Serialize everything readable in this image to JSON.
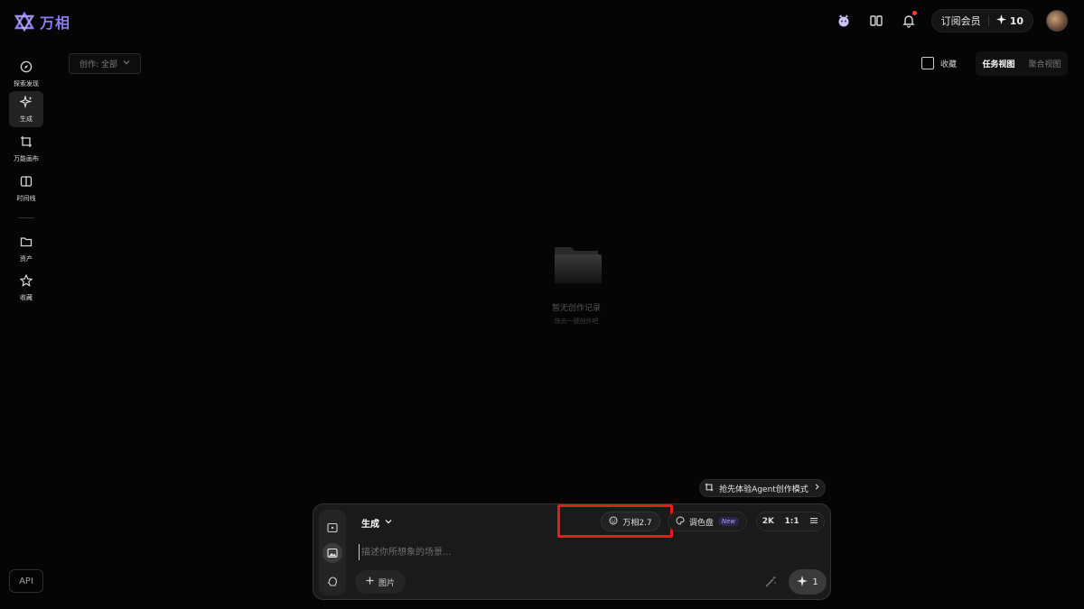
{
  "header": {
    "app_name": "万相",
    "member_label": "订阅会员",
    "points": "10"
  },
  "sidebar": {
    "items": [
      {
        "label": "探索发现",
        "icon": "compass-icon"
      },
      {
        "label": "生成",
        "icon": "sparkle-icon"
      },
      {
        "label": "万能画布",
        "icon": "crop-icon"
      },
      {
        "label": "时间线",
        "icon": "split-view-icon"
      },
      {
        "label": "资产",
        "icon": "folder-icon"
      },
      {
        "label": "收藏",
        "icon": "star-icon"
      }
    ],
    "api_label": "API"
  },
  "toolbar": {
    "filter_label": "创作: 全部",
    "favorites_label": "收藏",
    "view_tabs": [
      "任务视图",
      "聚合视图"
    ]
  },
  "empty_state": {
    "title": "暂无创作记录",
    "subtitle": "快去一键创作吧"
  },
  "agent_button": {
    "label": "抢先体验Agent创作模式"
  },
  "composer": {
    "mode_label": "生成",
    "model_label": "万相2.7",
    "palette_label": "调色盘",
    "new_badge": "New",
    "resolution": "2K",
    "aspect_ratio": "1:1",
    "prompt_placeholder": "描述你所想象的场景...",
    "add_image_label": "图片",
    "submit_count": "1"
  },
  "colors": {
    "accent": "#8b7cf6",
    "highlight": "#e11d1d",
    "background": "#050505"
  }
}
